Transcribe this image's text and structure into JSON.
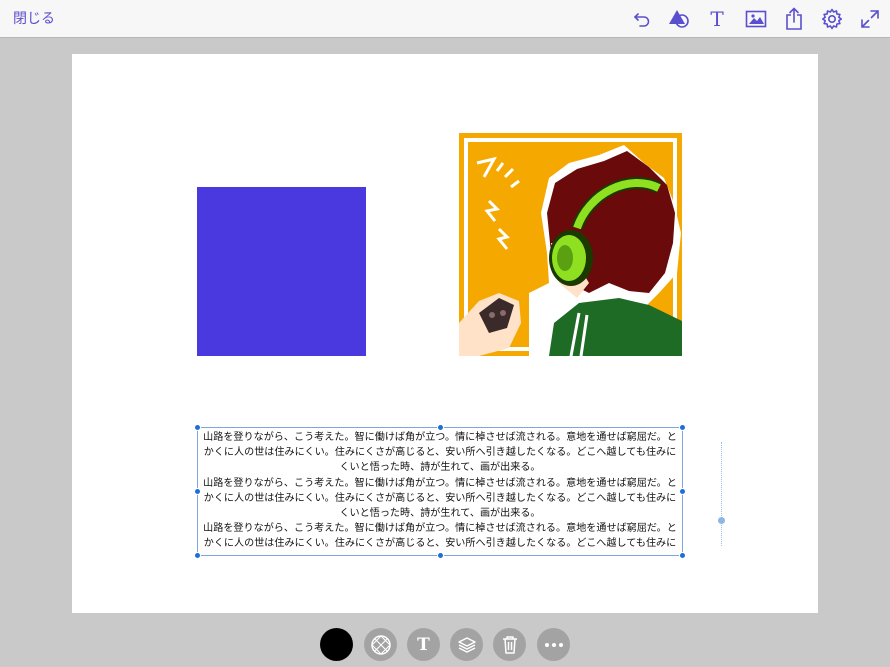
{
  "topbar": {
    "close_label": "閉じる",
    "icons": [
      "undo-icon",
      "shapes-icon",
      "text-icon",
      "image-icon",
      "share-icon",
      "settings-icon",
      "fullscreen-icon"
    ],
    "text_icon_glyph": "T",
    "accent_color": "#5a4fcf"
  },
  "canvas": {
    "shape_color": "#4b39e0",
    "illustration": {
      "description_icon": "boy-with-headphones-gaming-illustration",
      "background_color": "#f5a800",
      "headphone_color": "#8fe020"
    },
    "textbox": {
      "lines": [
        "山路を登りながら、こう考えた。智に働けば角が立つ。情に棹させば流される。意地を通せば窮屈だ。と",
        "かくに人の世は住みにくい。住みにくさが高じると、安い所へ引き越したくなる。どこへ越しても住みに",
        "くいと悟った時、詩が生れて、画が出来る。",
        "山路を登りながら、こう考えた。智に働けば角が立つ。情に棹させば流される。意地を通せば窮屈だ。と",
        "かくに人の世は住みにくい。住みにくさが高じると、安い所へ引き越したくなる。どこへ越しても住みに",
        "くいと悟った時、詩が生れて、画が出来る。",
        "山路を登りながら、こう考えた。智に働けば角が立つ。情に棹させば流される。意地を通せば窮屈だ。と",
        "かくに人の世は住みにくい。住みにくさが高じると、安い所へ引き越したくなる。どこへ越しても住みに"
      ]
    }
  },
  "bottombar": {
    "buttons": [
      "color-swatch",
      "pattern-icon",
      "text-icon",
      "layers-icon",
      "trash-icon",
      "more-icon"
    ],
    "text_glyph": "T",
    "swatch_color": "#000000"
  }
}
